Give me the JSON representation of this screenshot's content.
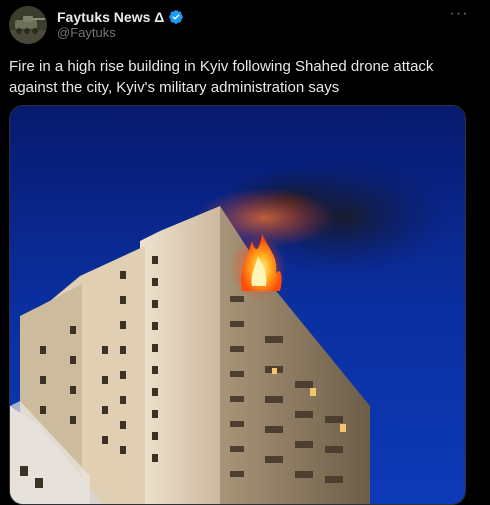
{
  "tweet": {
    "author": {
      "display_name": "Faytuks News Δ",
      "handle": "@Faytuks",
      "verified": true,
      "avatar_icon": "news-avatar"
    },
    "more_label": "···",
    "text": "Fire in a high rise building in Kyiv following Shahed drone attack against the city, Kyiv's military administration says",
    "media": {
      "type": "photo",
      "alt": "Burning high-rise apartment building at night"
    }
  },
  "colors": {
    "background": "#000000",
    "text_primary": "#e7e9ea",
    "text_secondary": "#71767b",
    "verified_badge": "#1d9bf0",
    "sky": "#0b2fa0",
    "fire": "#ff5a12"
  }
}
